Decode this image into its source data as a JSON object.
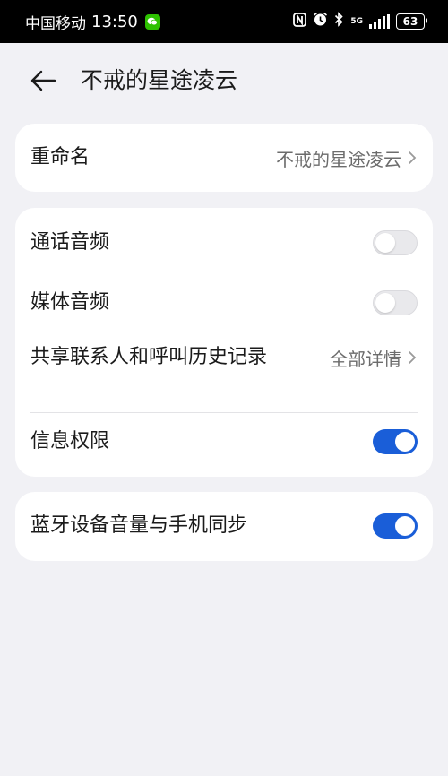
{
  "status_bar": {
    "carrier": "中国移动",
    "time": "13:50",
    "network": "5G",
    "battery": "63"
  },
  "header": {
    "title": "不戒的星途凌云"
  },
  "rename": {
    "label": "重命名",
    "value": "不戒的星途凌云"
  },
  "permissions": {
    "call_audio": {
      "label": "通话音频",
      "enabled": false
    },
    "media_audio": {
      "label": "媒体音频",
      "enabled": false
    },
    "share_contacts": {
      "label": "共享联系人和呼叫历史记录",
      "value": "全部详情"
    },
    "info_permission": {
      "label": "信息权限",
      "enabled": true
    }
  },
  "sync_volume": {
    "label": "蓝牙设备音量与手机同步",
    "enabled": true
  },
  "colors": {
    "accent": "#1a5ed8",
    "background": "#f1f1f5",
    "card": "#ffffff",
    "statusbar": "#000000"
  }
}
